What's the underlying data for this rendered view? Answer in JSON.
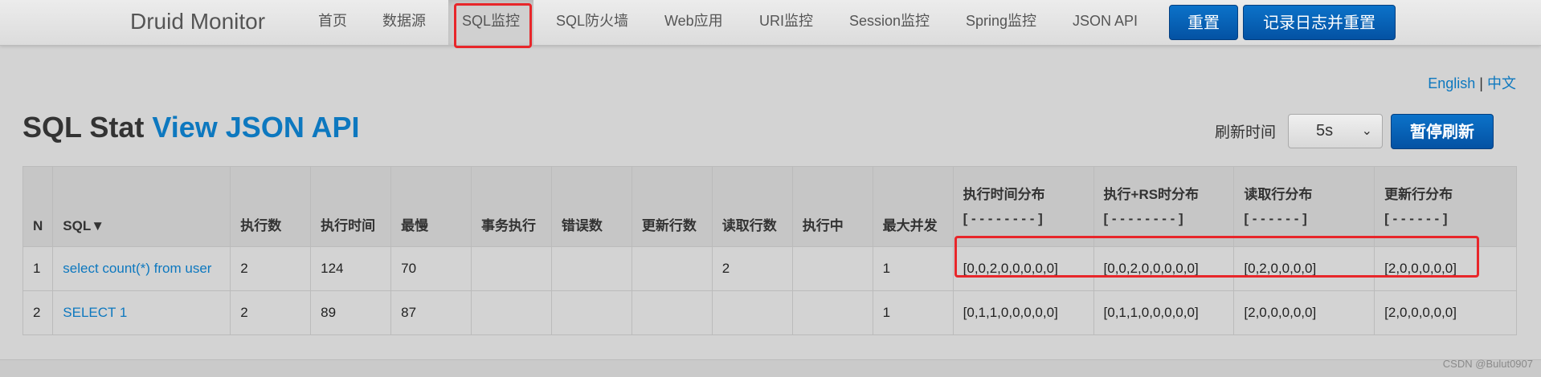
{
  "nav": {
    "brand": "Druid Monitor",
    "items": [
      "首页",
      "数据源",
      "SQL监控",
      "SQL防火墙",
      "Web应用",
      "URI监控",
      "Session监控",
      "Spring监控",
      "JSON API"
    ],
    "active": "SQL监控",
    "reset_button": "重置",
    "log_reset_button": "记录日志并重置"
  },
  "lang": {
    "english": "English",
    "separator": "|",
    "chinese": "中文"
  },
  "header": {
    "title": "SQL Stat",
    "json_link": "View JSON API",
    "refresh_label": "刷新时间",
    "refresh_value": "5s",
    "pause_button": "暂停刷新"
  },
  "table": {
    "columns": [
      "N",
      "SQL▼",
      "执行数",
      "执行时间",
      "最慢",
      "事务执行",
      "错误数",
      "更新行数",
      "读取行数",
      "执行中",
      "最大并发"
    ],
    "dist_columns": [
      {
        "label": "执行时间分布",
        "sub": "[ - - - - - - - - ]"
      },
      {
        "label": "执行+RS时分布",
        "sub": "[ - - - - - - - - ]"
      },
      {
        "label": "读取行分布",
        "sub": "[ - - - - - - ]"
      },
      {
        "label": "更新行分布",
        "sub": "[ - - - - - - ]"
      }
    ],
    "rows": [
      [
        "1",
        "select count(*) from user",
        "2",
        "124",
        "70",
        "",
        "",
        "",
        "2",
        "",
        "1",
        "[0,0,2,0,0,0,0,0]",
        "[0,0,2,0,0,0,0,0]",
        "[0,2,0,0,0,0]",
        "[2,0,0,0,0,0]"
      ],
      [
        "2",
        "SELECT 1",
        "2",
        "89",
        "87",
        "",
        "",
        "",
        "",
        "",
        "1",
        "[0,1,1,0,0,0,0,0]",
        "[0,1,1,0,0,0,0,0]",
        "[2,0,0,0,0,0]",
        "[2,0,0,0,0,0]"
      ]
    ]
  },
  "watermark": "CSDN @Bulut0907",
  "colors": {
    "accent": "#0d78bf",
    "highlight": "#e8262a",
    "button": "#0452a3"
  }
}
